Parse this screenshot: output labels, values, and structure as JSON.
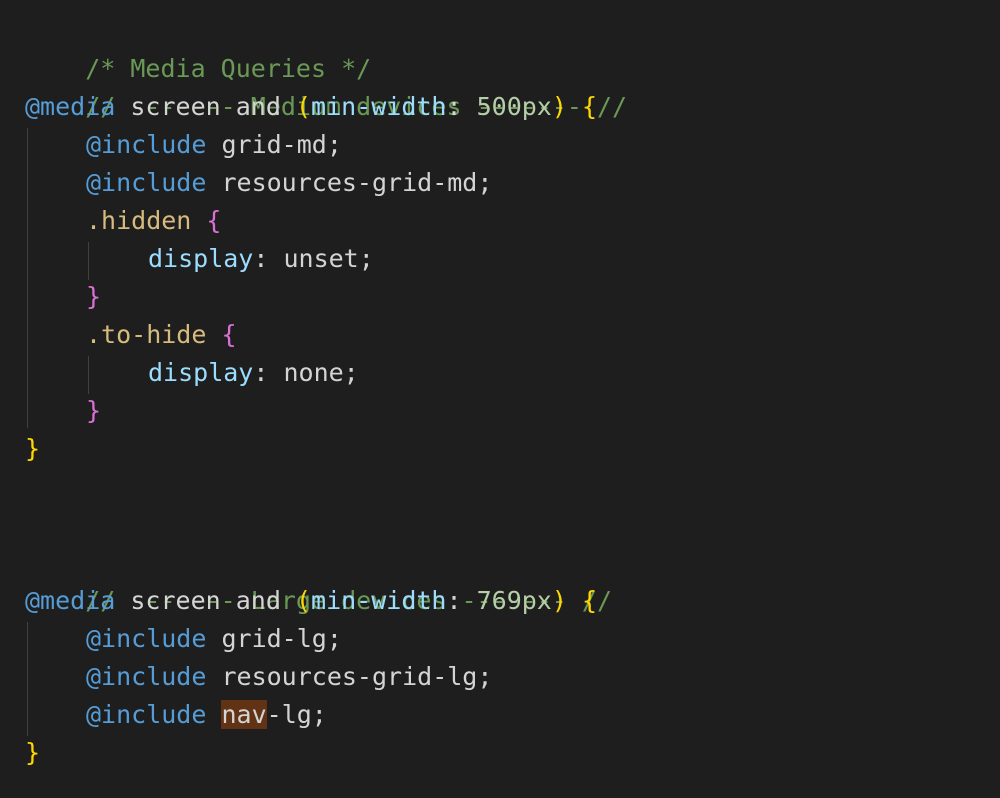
{
  "editor": {
    "colors": {
      "background": "#1e1e1e",
      "comment": "#6a9955",
      "keyword": "#569cd6",
      "property": "#9cdcfe",
      "number": "#b5cea8",
      "selector": "#d7ba7d",
      "brace_outer": "#ffd700",
      "brace_inner": "#da70d6",
      "highlight": "#613214"
    },
    "lines": {
      "l1_comment": "/* Media Queries */",
      "l2_comment": "// ------- Medium devices ------- //",
      "l3_at": "@media",
      "l3_screen": " screen ",
      "l3_and": "and",
      "l3_sp": " ",
      "l3_paren_open": "(",
      "l3_prop": "min-width",
      "l3_colon": ": ",
      "l3_num": "500px",
      "l3_paren_close": ")",
      "l3_sp2": " ",
      "l3_brace": "{",
      "l4_at": "@include",
      "l4_rest": " grid-md;",
      "l5_at": "@include",
      "l5_rest": " resources-grid-md;",
      "l6_selector": ".hidden",
      "l6_sp": " ",
      "l6_brace": "{",
      "l7_prop": "display",
      "l7_rest": ": unset;",
      "l8_brace": "}",
      "l9_selector": ".to-hide",
      "l9_sp": " ",
      "l9_brace": "{",
      "l10_prop": "display",
      "l10_rest": ": none;",
      "l11_brace": "}",
      "l12_brace": "}",
      "l15_comment": "// ------- Large devices ------- //",
      "l16_at": "@media",
      "l16_screen": " screen ",
      "l16_and": "and",
      "l16_sp": " ",
      "l16_paren_open": "(",
      "l16_prop": "min-width",
      "l16_colon": ": ",
      "l16_num": "769px",
      "l16_paren_close": ")",
      "l16_sp2": " ",
      "l16_brace": "{",
      "l17_at": "@include",
      "l17_rest": " grid-lg;",
      "l18_at": "@include",
      "l18_rest": " resources-grid-lg;",
      "l19_at": "@include",
      "l19_sp": " ",
      "l19_hl": "nav",
      "l19_rest": "-lg;",
      "l20_brace": "}"
    }
  }
}
